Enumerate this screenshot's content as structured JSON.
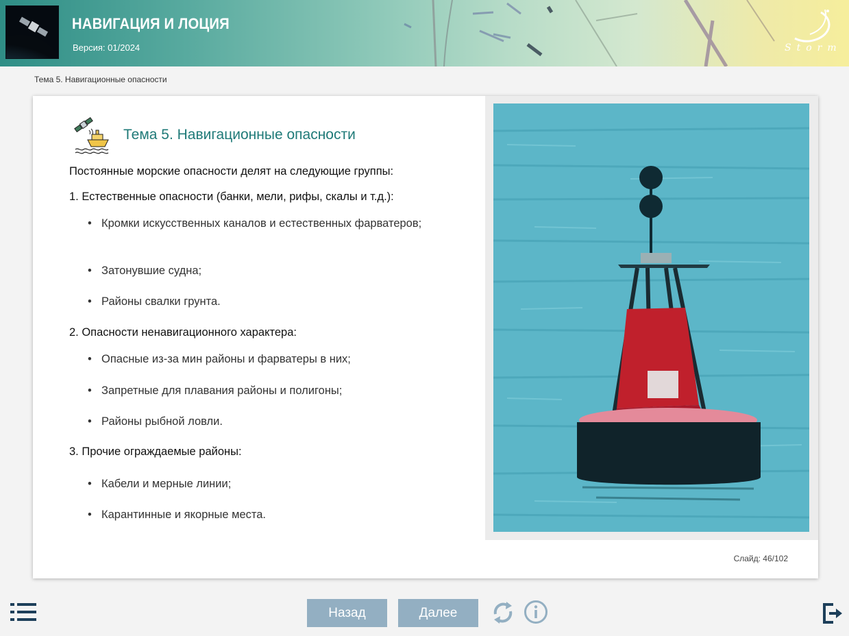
{
  "header": {
    "title": "НАВИГАЦИЯ И ЛОЦИЯ",
    "version": "Версия: 01/2024",
    "logo_text": "Storm"
  },
  "breadcrumb": "Тема 5. Навигационные опасности",
  "slide": {
    "title": "Тема 5. Навигационные опасности",
    "intro": "Постоянные морские опасности делят на следующие группы:",
    "groups": [
      {
        "heading": "1. Естественные опасности (банки, мели, рифы, скалы и т.д.):",
        "items": [
          "Кромки искусственных каналов и естественных фарватеров;",
          "Затонувшие судна;",
          "Районы свалки грунта."
        ]
      },
      {
        "heading": "2. Опасности ненавигационного характера:",
        "items": [
          "Опасные из-за мин районы и фарватеры в них;",
          "Запретные для плавания районы и полигоны;",
          "Районы рыбной ловли."
        ]
      },
      {
        "heading": "3. Прочие ограждаемые районы:",
        "items": [
          "Кабели и мерные линии;",
          "Карантинные и якорные места."
        ]
      }
    ],
    "counter": "Слайд:  46/102"
  },
  "footer": {
    "back_label": "Назад",
    "next_label": "Далее"
  },
  "icons": {
    "menu": "list-icon",
    "reload": "reload-icon",
    "info": "info-icon",
    "exit": "exit-icon"
  },
  "colors": {
    "title": "#1f7a78",
    "button": "#93afc2",
    "icon": "#1d3f5a"
  }
}
